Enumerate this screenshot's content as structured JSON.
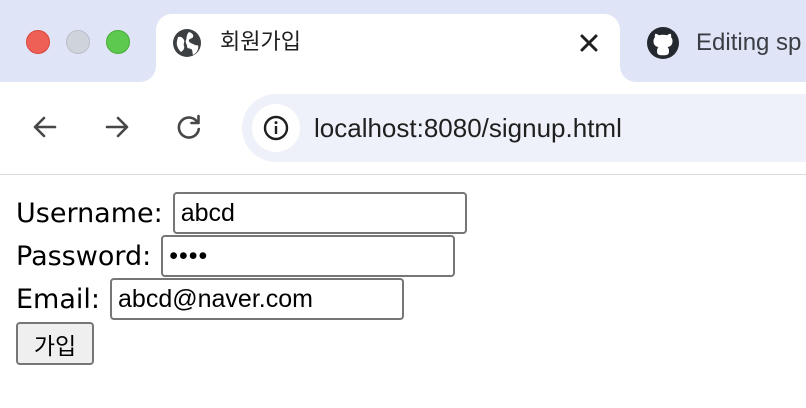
{
  "browser": {
    "active_tab": {
      "title": "회원가입",
      "favicon": "globe-icon",
      "close_icon": "close-icon"
    },
    "inactive_tab": {
      "title": "Editing sp",
      "favicon": "github-icon"
    },
    "toolbar": {
      "back_icon": "arrow-left-icon",
      "forward_icon": "arrow-right-icon",
      "reload_icon": "reload-icon",
      "site_info_icon": "info-icon",
      "url": "localhost:8080/signup.html"
    },
    "colors": {
      "tabstrip_bg": "#dfe5f6",
      "omnibox_bg": "#eef1f9",
      "close_light": "#ee5f56",
      "minimize_light": "#cfd3dc",
      "maximize_light": "#5dc94f"
    }
  },
  "form": {
    "username": {
      "label": "Username:",
      "value": "abcd"
    },
    "password": {
      "label": "Password:",
      "value": "abcd"
    },
    "email": {
      "label": "Email:",
      "value": "abcd@naver.com"
    },
    "submit_label": "가입"
  }
}
